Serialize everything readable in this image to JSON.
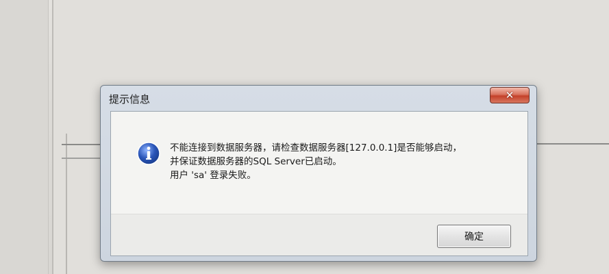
{
  "dialog": {
    "title": "提示信息",
    "close_label": "✕",
    "icon": "info-icon",
    "message_lines": [
      "不能连接到数据服务器，请检查数据服务器[127.0.0.1]是否能够启动，",
      "并保证数据服务器的SQL Server已启动。",
      "用户 'sa' 登录失败。"
    ],
    "ok_label": "确定"
  },
  "colors": {
    "close_button": "#c4412a",
    "info_icon_blue": "#2a55b8"
  }
}
